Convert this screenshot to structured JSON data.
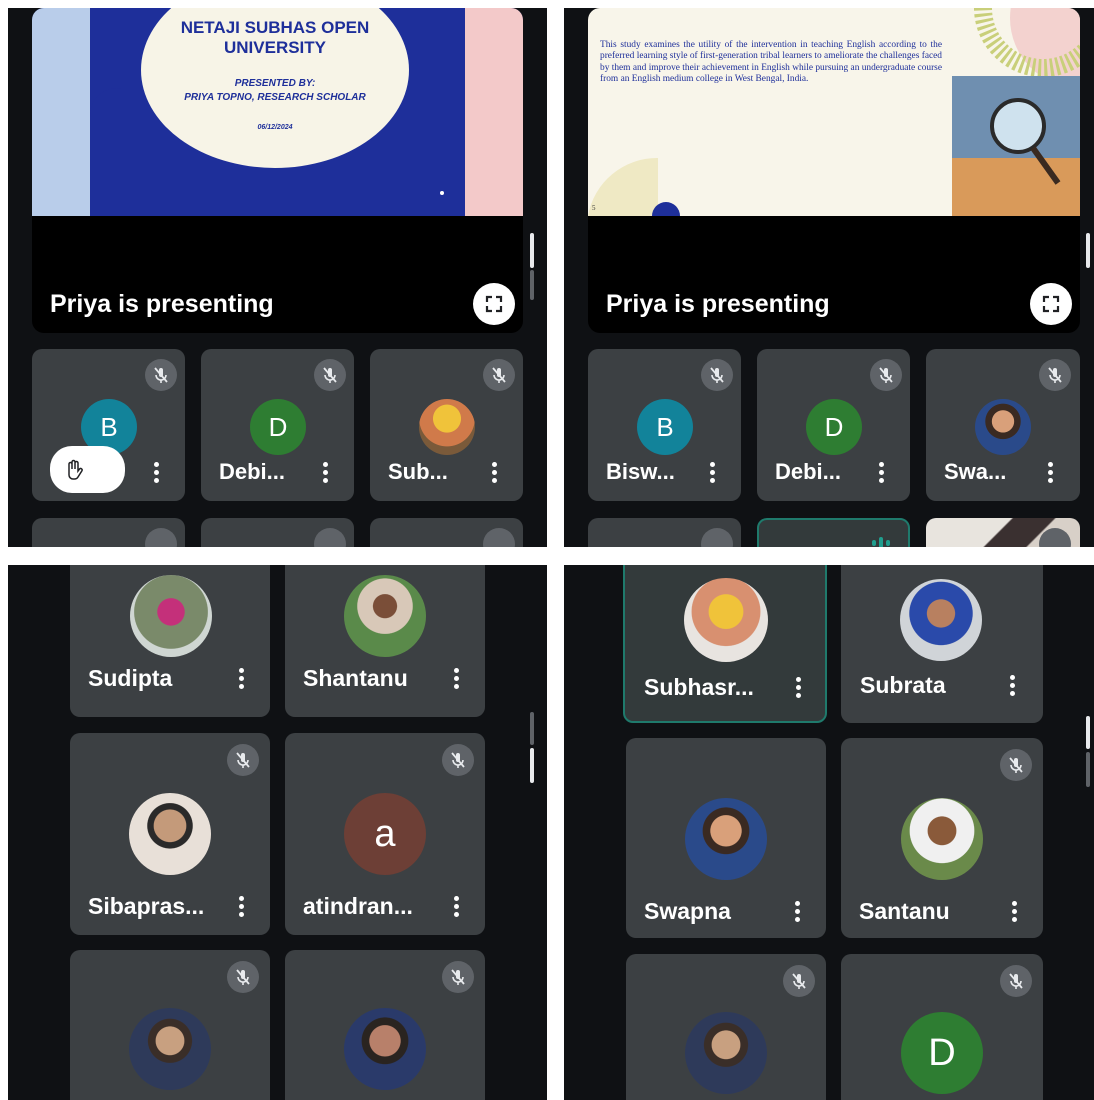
{
  "panel1": {
    "slide": {
      "university": "NETAJI SUBHAS OPEN UNIVERSITY",
      "presented_by": "PRESENTED BY:",
      "presenter": "PRIYA TOPNO, RESEARCH SCHOLAR",
      "date": "06/12/2024"
    },
    "presenting_label": "Priya is presenting",
    "tiles": [
      {
        "initial": "B",
        "name": "",
        "avatar_color": "#12839a",
        "raised_hand": true
      },
      {
        "initial": "D",
        "name": "Debi...",
        "avatar_color": "#2e7d32"
      },
      {
        "initial": "",
        "name": "Sub...",
        "photo": true
      }
    ]
  },
  "panel2": {
    "slide": {
      "abstract": "This study examines the utility of the intervention in teaching English according to the preferred learning style of first-generation tribal learners to ameliorate the challenges faced by them and improve their achievement in English while pursuing an undergraduate course from an English medium college in West Bengal, India.",
      "page_number": "5"
    },
    "presenting_label": "Priya is presenting",
    "tiles": [
      {
        "initial": "B",
        "name": "Bisw...",
        "avatar_color": "#12839a"
      },
      {
        "initial": "D",
        "name": "Debi...",
        "avatar_color": "#2e7d32"
      },
      {
        "initial": "",
        "name": "Swa...",
        "photo": true
      }
    ]
  },
  "panel3": {
    "tiles": [
      {
        "name": "Sudipta",
        "photo": true
      },
      {
        "name": "Shantanu",
        "photo": true
      },
      {
        "name": "Sibapras...",
        "photo": true,
        "muted": true
      },
      {
        "name": "atindran...",
        "initial": "a",
        "avatar_color": "#6d3f36",
        "muted": true
      },
      {
        "name": "",
        "photo": true,
        "muted": true
      },
      {
        "name": "",
        "photo": true,
        "muted": true
      }
    ]
  },
  "panel4": {
    "tiles": [
      {
        "name": "Subhasr...",
        "photo": true,
        "speaking": true
      },
      {
        "name": "Subrata",
        "photo": true
      },
      {
        "name": "Swapna",
        "photo": true
      },
      {
        "name": "Santanu",
        "photo": true,
        "muted": true
      },
      {
        "name": "",
        "photo": true,
        "muted": true
      },
      {
        "name": "",
        "initial": "D",
        "avatar_color": "#2e7d32",
        "muted": true
      }
    ]
  },
  "colors": {
    "background": "#0f1114",
    "tile": "#3c4043",
    "speaking_border": "#1f7a6c"
  },
  "icons": [
    "mic-off-icon",
    "more-vert-icon",
    "fullscreen-icon",
    "raised-hand-icon"
  ]
}
